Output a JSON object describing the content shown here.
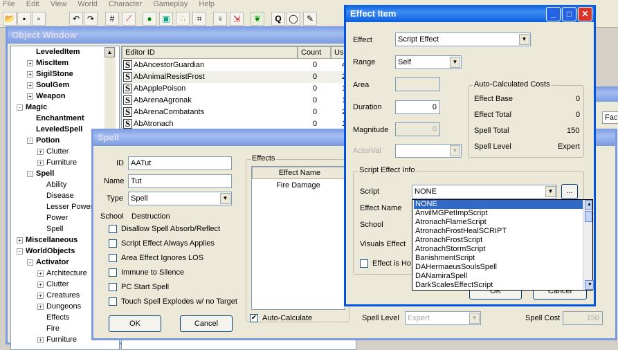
{
  "menu": [
    "File",
    "Edit",
    "View",
    "World",
    "Character",
    "Gameplay",
    "Help"
  ],
  "object_window": {
    "title": "Object Window",
    "tree": [
      {
        "label": "LeveledItem",
        "bold": true,
        "level": 1,
        "exp": ""
      },
      {
        "label": "MiscItem",
        "bold": true,
        "level": 1,
        "exp": "+"
      },
      {
        "label": "SigilStone",
        "bold": true,
        "level": 1,
        "exp": "+"
      },
      {
        "label": "SoulGem",
        "bold": true,
        "level": 1,
        "exp": "+"
      },
      {
        "label": "Weapon",
        "bold": true,
        "level": 1,
        "exp": "+"
      },
      {
        "label": "Magic",
        "bold": true,
        "level": 0,
        "exp": "-"
      },
      {
        "label": "Enchantment",
        "bold": true,
        "level": 1,
        "exp": ""
      },
      {
        "label": "LeveledSpell",
        "bold": true,
        "level": 1,
        "exp": ""
      },
      {
        "label": "Potion",
        "bold": true,
        "level": 1,
        "exp": "-"
      },
      {
        "label": "Clutter",
        "bold": false,
        "level": 2,
        "exp": "+"
      },
      {
        "label": "Furniture",
        "bold": false,
        "level": 2,
        "exp": "+"
      },
      {
        "label": "Spell",
        "bold": true,
        "level": 1,
        "exp": "-"
      },
      {
        "label": "Ability",
        "bold": false,
        "level": 2,
        "exp": ""
      },
      {
        "label": "Disease",
        "bold": false,
        "level": 2,
        "exp": ""
      },
      {
        "label": "Lesser Power",
        "bold": false,
        "level": 2,
        "exp": ""
      },
      {
        "label": "Power",
        "bold": false,
        "level": 2,
        "exp": ""
      },
      {
        "label": "Spell",
        "bold": false,
        "level": 2,
        "exp": ""
      },
      {
        "label": "Miscellaneous",
        "bold": true,
        "level": 0,
        "exp": "+"
      },
      {
        "label": "WorldObjects",
        "bold": true,
        "level": 0,
        "exp": "-"
      },
      {
        "label": "Activator",
        "bold": true,
        "level": 1,
        "exp": "-"
      },
      {
        "label": "Architecture",
        "bold": false,
        "level": 2,
        "exp": "+"
      },
      {
        "label": "Clutter",
        "bold": false,
        "level": 2,
        "exp": "+"
      },
      {
        "label": "Creatures",
        "bold": false,
        "level": 2,
        "exp": "+"
      },
      {
        "label": "Dungeons",
        "bold": false,
        "level": 2,
        "exp": "+"
      },
      {
        "label": "Effects",
        "bold": false,
        "level": 2,
        "exp": ""
      },
      {
        "label": "Fire",
        "bold": false,
        "level": 2,
        "exp": ""
      },
      {
        "label": "Furniture",
        "bold": false,
        "level": 2,
        "exp": "+"
      }
    ],
    "columns": [
      "Editor ID",
      "Count",
      "Us"
    ],
    "rows": [
      {
        "id": "AbAncestorGuardian",
        "count": "0",
        "us": "4"
      },
      {
        "id": "AbAnimalResistFrost",
        "count": "0",
        "us": "2"
      },
      {
        "id": "AbApplePoison",
        "count": "0",
        "us": "1"
      },
      {
        "id": "AbArenaAgronak",
        "count": "0",
        "us": "1"
      },
      {
        "id": "AbArenaCombatants",
        "count": "0",
        "us": "2"
      },
      {
        "id": "AbAtronach",
        "count": "0",
        "us": "1"
      }
    ]
  },
  "spell_window": {
    "title": "Spell",
    "id_label": "ID",
    "id_value": "AATut",
    "name_label": "Name",
    "name_value": "Tut",
    "type_label": "Type",
    "type_value": "Spell",
    "school_label": "School",
    "school_value": "Destruction",
    "checkboxes": [
      "Disallow Spell Absorb/Reflect",
      "Script Effect Always Applies",
      "Area Effect Ignores LOS",
      "Immune to Silence",
      "PC Start Spell",
      "Touch Spell Explodes w/ no Target"
    ],
    "effects_label": "Effects",
    "effects_col": "Effect Name",
    "effects_rows": [
      "Fire Damage"
    ],
    "ok": "OK",
    "cancel": "Cancel",
    "auto_calc": "Auto-Calculate",
    "spell_level_label": "Spell Level",
    "spell_level_value": "Expert",
    "spell_cost_label": "Spell Cost",
    "spell_cost_value": "150"
  },
  "effect_window": {
    "title": "Effect Item",
    "effect_label": "Effect",
    "effect_value": "Script Effect",
    "range_label": "Range",
    "range_value": "Self",
    "area_label": "Area",
    "duration_label": "Duration",
    "duration_value": "0",
    "magnitude_label": "Magnitude",
    "magnitude_value": "0",
    "actorval_label": "ActorVal",
    "auto_group": "Auto-Calculated Costs",
    "effect_base_label": "Effect Base",
    "effect_base_value": "0",
    "effect_total_label": "Effect Total",
    "effect_total_value": "0",
    "spell_total_label": "Spell Total",
    "spell_total_value": "150",
    "spell_level_label": "Spell Level",
    "spell_level_value": "Expert",
    "script_group": "Script Effect Info",
    "script_label": "Script",
    "script_value": "NONE",
    "browse": "...",
    "effect_name_label": "Effect Name",
    "school_label": "School",
    "visuals_label": "Visuals Effect",
    "hostile_label": "Effect is Ho",
    "ok": "OK",
    "cancel": "Cancel",
    "dropdown": [
      "NONE",
      "AnvilMGPetImpScript",
      "AtronachFlameScript",
      "AtronachFrostHealSCRIPT",
      "AtronachFrostScript",
      "AtronachStormScript",
      "BanishmentScript",
      "DAHermaeusSoulsSpell",
      "DANamiraSpell",
      "DarkScalesEffectScript"
    ]
  },
  "right_edge": {
    "tab": "Fac"
  }
}
